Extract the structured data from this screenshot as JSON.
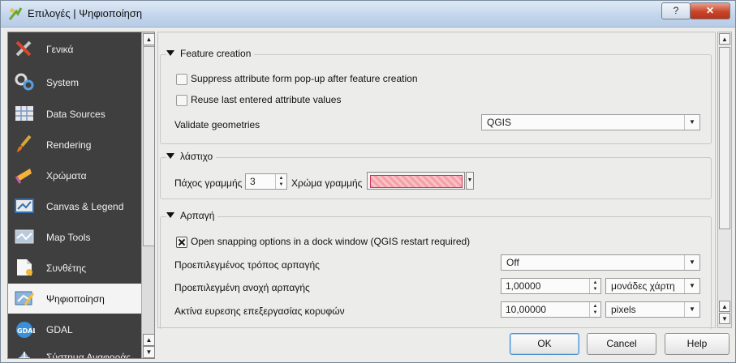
{
  "window": {
    "title": "Επιλογές | Ψηφιοποίηση",
    "help_glyph": "?",
    "close_glyph": "✕"
  },
  "sidebar": {
    "items": [
      {
        "label": "Γενικά",
        "icon": "tools-icon"
      },
      {
        "label": "System",
        "icon": "gears-icon"
      },
      {
        "label": "Data Sources",
        "icon": "table-icon"
      },
      {
        "label": "Rendering",
        "icon": "brush-icon"
      },
      {
        "label": "Χρώματα",
        "icon": "palette-icon"
      },
      {
        "label": "Canvas & Legend",
        "icon": "canvas-icon"
      },
      {
        "label": "Map Tools",
        "icon": "map-tools-icon"
      },
      {
        "label": "Συνθέτης",
        "icon": "composer-icon"
      },
      {
        "label": "Ψηφιοποίηση",
        "icon": "digitizing-icon",
        "selected": true
      },
      {
        "label": "GDAL",
        "icon": "gdal-icon"
      },
      {
        "label": "Σύστημα Αναφοράς",
        "icon": "crs-icon"
      }
    ]
  },
  "feature_creation": {
    "title": "Feature creation",
    "suppress_form": {
      "label": "Suppress attribute form pop-up after feature creation",
      "checked": false
    },
    "reuse_values": {
      "label": "Reuse last entered attribute values",
      "checked": false
    },
    "validate_label": "Validate geometries",
    "validate_value": "QGIS"
  },
  "rubberband": {
    "title": "λάστιχο",
    "line_width_label": "Πάχος γραμμής",
    "line_width_value": "3",
    "line_color_label": "Χρώμα γραμμής",
    "line_color": "#f5a0a8"
  },
  "snapping": {
    "title": "Αρπαγή",
    "dock_option": {
      "label": "Open snapping options in a dock window (QGIS restart required)",
      "checked": true
    },
    "default_mode_label": "Προεπιλεγμένος τρόπος αρπαγής",
    "default_mode_value": "Off",
    "tolerance_label": "Προεπιλεγμένη ανοχή αρπαγής",
    "tolerance_value": "1,00000",
    "tolerance_units": "μονάδες χάρτη",
    "search_radius_label": "Ακτίνα ευρεσης επεξεργασίας κορυφών",
    "search_radius_value": "10,00000",
    "search_radius_units": "pixels"
  },
  "buttons": {
    "ok": "OK",
    "cancel": "Cancel",
    "help": "Help"
  },
  "glyphs": {
    "up": "▲",
    "down": "▼"
  },
  "colors": {
    "sidebar_bg": "#3f3f3f",
    "selected_bg": "#f4f4f4",
    "ok_border": "#4d8fd0"
  }
}
